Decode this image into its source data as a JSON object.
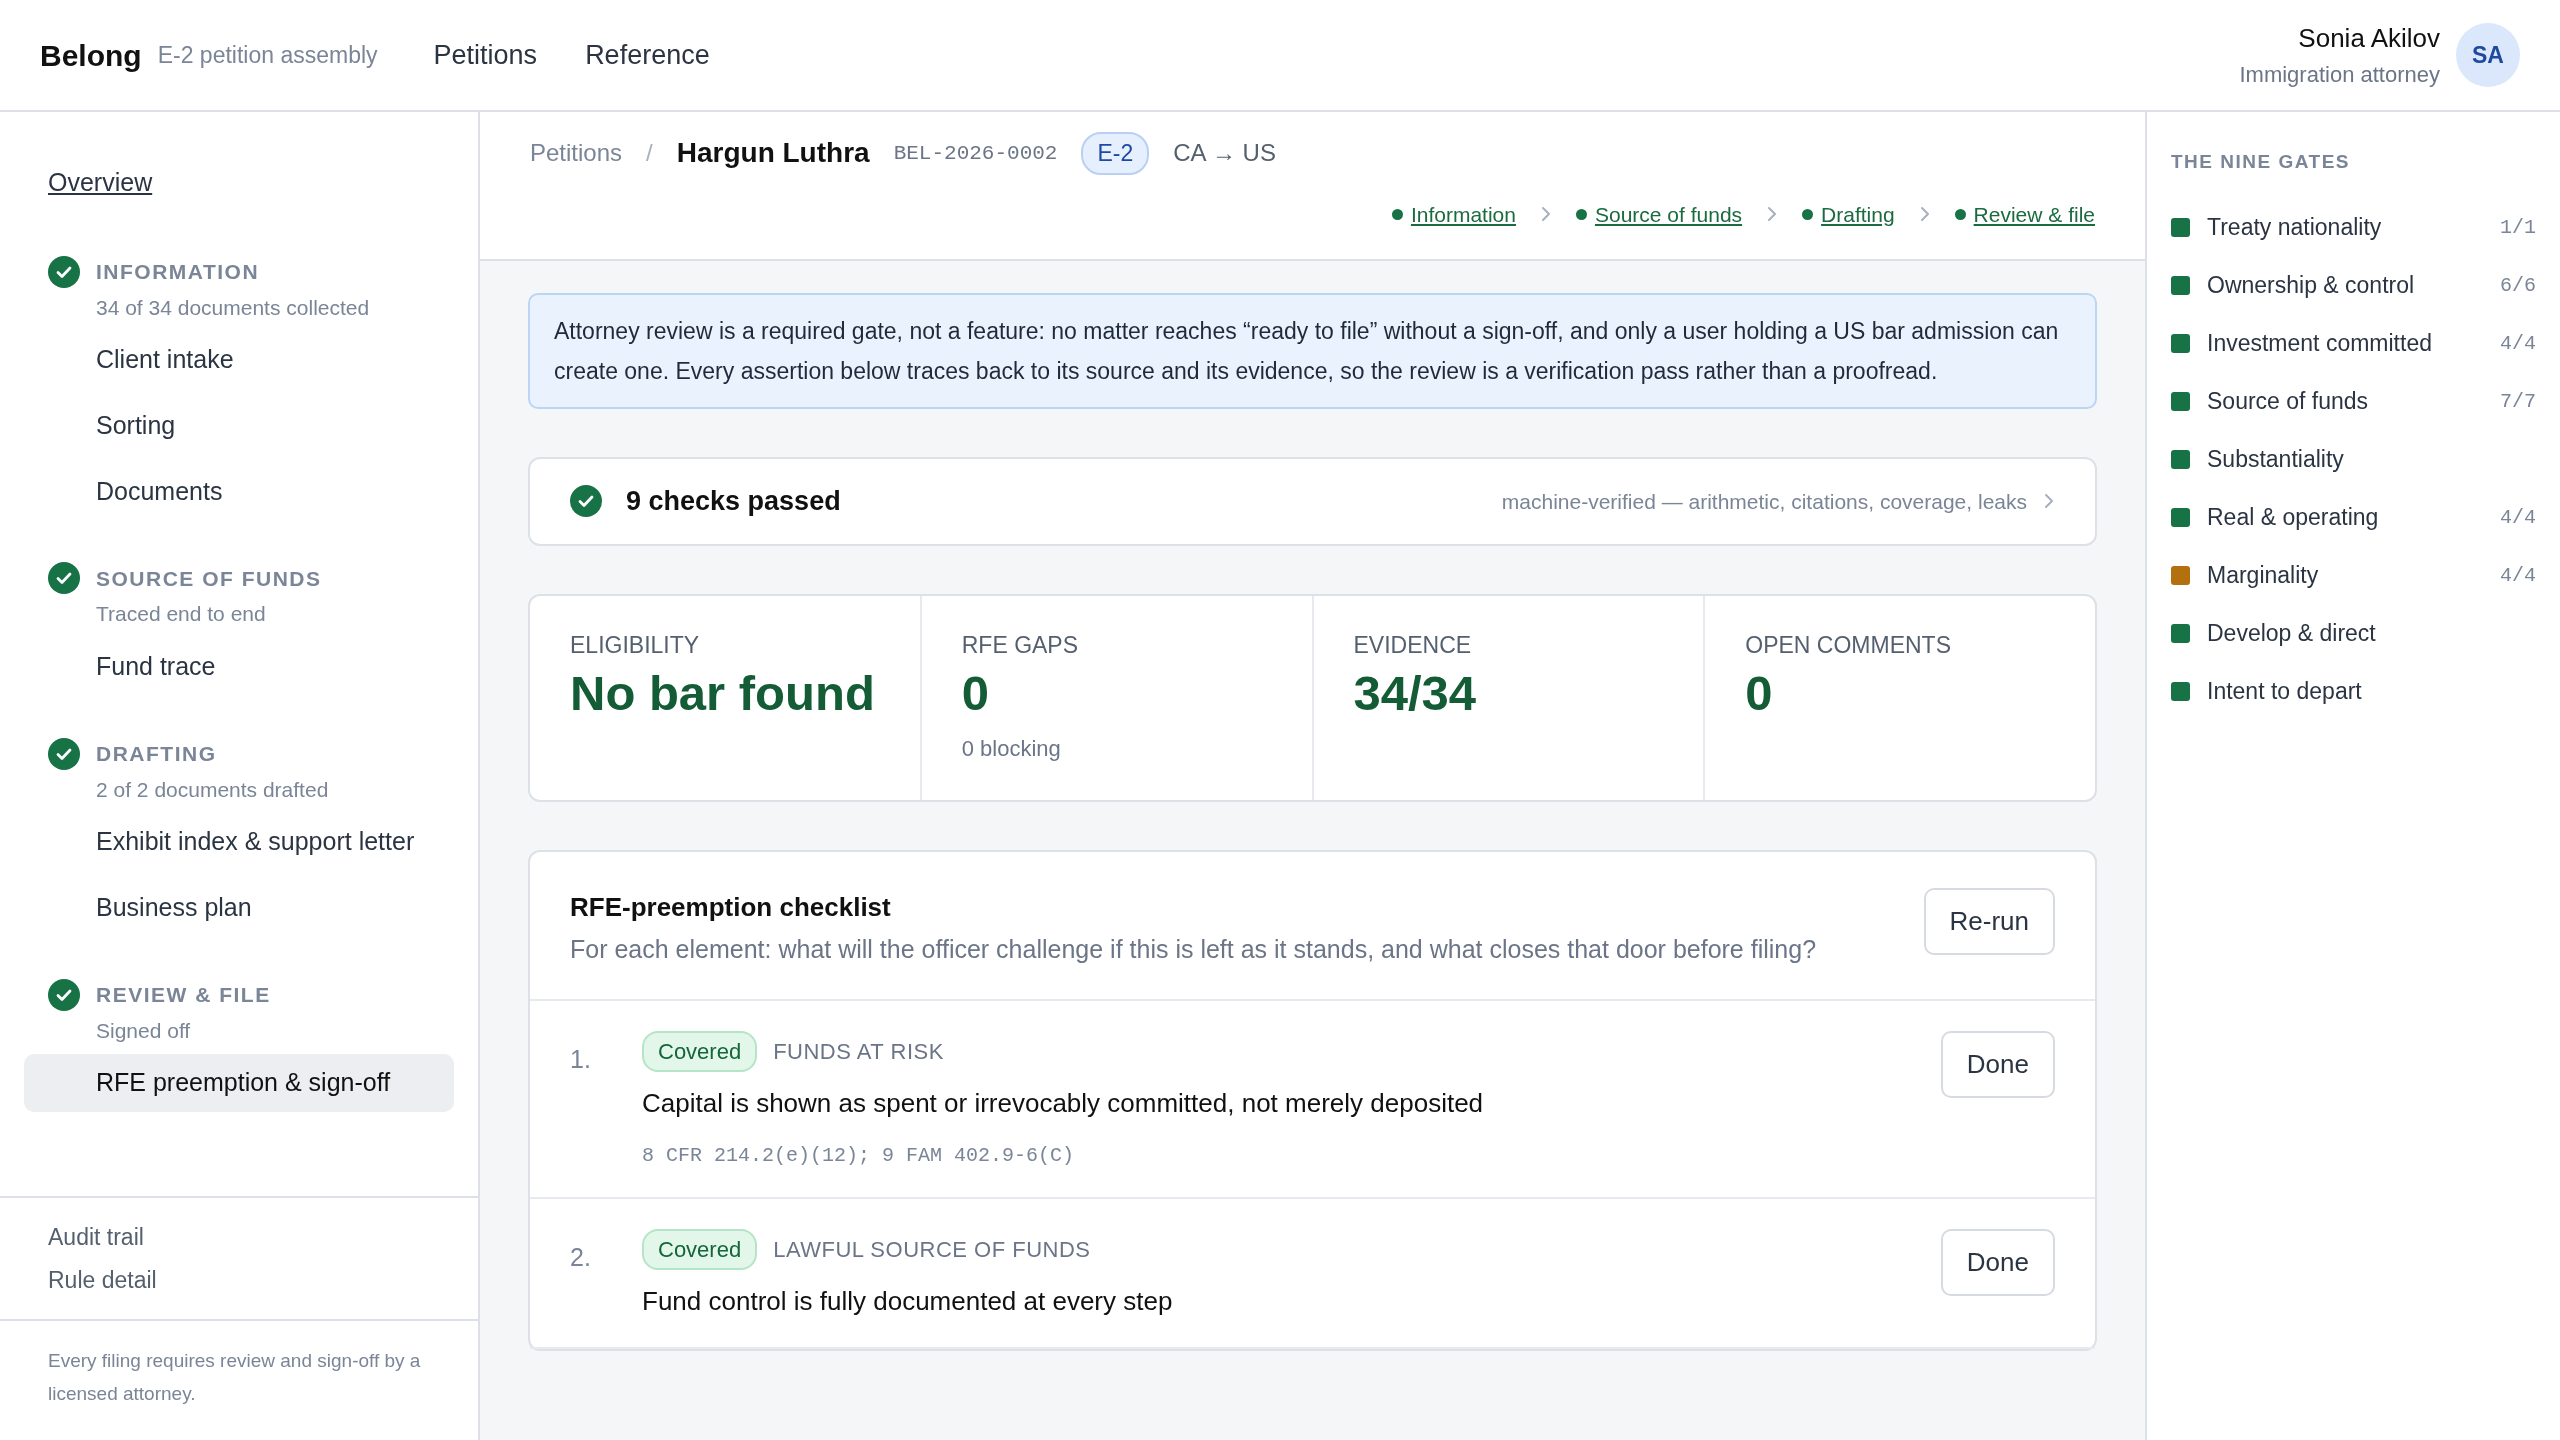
{
  "app": {
    "brand": "Belong",
    "subtitle": "E-2 petition assembly"
  },
  "nav": [
    {
      "label": "Petitions"
    },
    {
      "label": "Reference"
    }
  ],
  "user": {
    "name": "Sonia Akilov",
    "role": "Immigration attorney",
    "initials": "SA"
  },
  "sidebar": {
    "overview": "Overview",
    "sections": [
      {
        "title": "INFORMATION",
        "subtitle": "34 of 34 documents collected",
        "done": true,
        "items": [
          {
            "label": "Client intake",
            "selected": false
          },
          {
            "label": "Sorting",
            "selected": false
          },
          {
            "label": "Documents",
            "selected": false
          }
        ]
      },
      {
        "title": "SOURCE OF FUNDS",
        "subtitle": "Traced end to end",
        "done": true,
        "items": [
          {
            "label": "Fund trace",
            "selected": false
          }
        ]
      },
      {
        "title": "DRAFTING",
        "subtitle": "2 of 2 documents drafted",
        "done": true,
        "items": [
          {
            "label": "Exhibit index & support letter",
            "selected": false
          },
          {
            "label": "Business plan",
            "selected": false
          }
        ]
      },
      {
        "title": "REVIEW & FILE",
        "subtitle": "Signed off",
        "done": true,
        "items": [
          {
            "label": "RFE preemption & sign-off",
            "selected": true
          }
        ]
      }
    ],
    "links": [
      {
        "label": "Audit trail"
      },
      {
        "label": "Rule detail"
      }
    ],
    "note": "Every filing requires review and sign-off by a licensed attorney."
  },
  "header": {
    "breadcrumb": "Petitions",
    "separator": "/",
    "name": "Hargun Luthra",
    "case_id": "BEL-2026-0002",
    "visa": "E-2",
    "route": "CA → US",
    "steps": [
      {
        "label": "Information",
        "done": true
      },
      {
        "label": "Source of funds",
        "done": true
      },
      {
        "label": "Drafting",
        "done": true
      },
      {
        "label": "Review & file",
        "done": true
      }
    ]
  },
  "callout": "Attorney review is a required gate, not a feature: no matter reaches “ready to file” without a sign-off, and only a user holding a US bar admission can create one. Every assertion below traces back to its source and its evidence, so the review is a verification pass rather than a proofread.",
  "checks": {
    "title": "9 checks passed",
    "detail": "machine-verified — arithmetic, citations, coverage, leaks",
    "passed": true
  },
  "stats": [
    {
      "label": "ELIGIBILITY",
      "value": "No bar found"
    },
    {
      "label": "RFE GAPS",
      "value": "0",
      "note": "0 blocking"
    },
    {
      "label": "EVIDENCE",
      "value": "34/34"
    },
    {
      "label": "OPEN COMMENTS",
      "value": "0"
    }
  ],
  "checklist": {
    "title": "RFE-preemption checklist",
    "description": "For each element: what will the officer challenge if this is left as it stands, and what closes that door before filing?",
    "action": "Re-run",
    "items": [
      {
        "number": "1.",
        "status": "Covered",
        "category": "FUNDS AT RISK",
        "text": "Capital is shown as spent or irrevocably committed, not merely deposited",
        "citation": "8 CFR 214.2(e)(12); 9 FAM 402.9-6(C)",
        "action": "Done"
      },
      {
        "number": "2.",
        "status": "Covered",
        "category": "LAWFUL SOURCE OF FUNDS",
        "text": "Fund control is fully documented at every step",
        "action": "Done"
      }
    ]
  },
  "gates": {
    "title": "THE NINE GATES",
    "items": [
      {
        "label": "Treaty nationality",
        "count": "1/1",
        "color": "#177245"
      },
      {
        "label": "Ownership & control",
        "count": "6/6",
        "color": "#177245"
      },
      {
        "label": "Investment committed",
        "count": "4/4",
        "color": "#177245"
      },
      {
        "label": "Source of funds",
        "count": "7/7",
        "color": "#177245"
      },
      {
        "label": "Substantiality",
        "color": "#177245"
      },
      {
        "label": "Real & operating",
        "count": "4/4",
        "color": "#177245"
      },
      {
        "label": "Marginality",
        "count": "4/4",
        "color": "#b3700f"
      },
      {
        "label": "Develop & direct",
        "color": "#177245"
      },
      {
        "label": "Intent to depart",
        "color": "#177245"
      }
    ]
  }
}
